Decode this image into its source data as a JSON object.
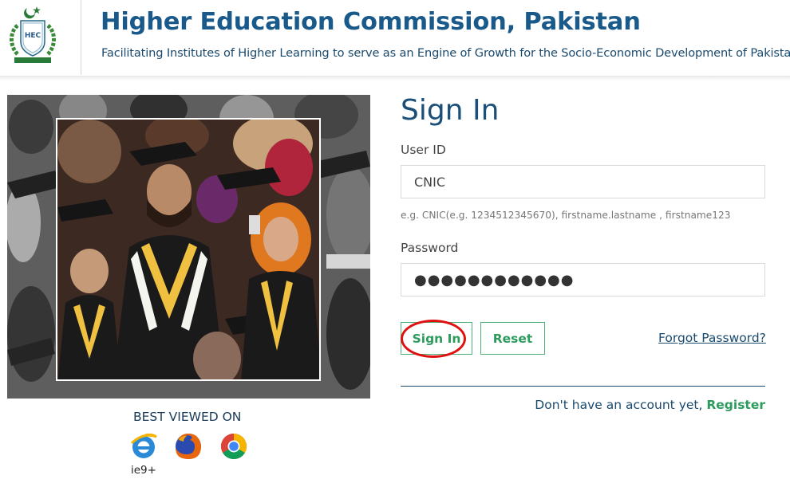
{
  "header": {
    "title": "Higher Education Commission, Pakistan",
    "tagline": "Facilitating Institutes of Higher Learning to serve as an Engine of Growth for the Socio-Economic Development of Pakistan",
    "logo_text": "HEC",
    "colors": {
      "title": "#1a5a8a",
      "logo_green": "#2a7a3a"
    }
  },
  "hero": {
    "icon": "graduates-photo"
  },
  "browsers": {
    "heading": "BEST VIEWED ON",
    "ie_label": "ie9+",
    "icons": [
      "ie-icon",
      "firefox-icon",
      "chrome-icon"
    ]
  },
  "form": {
    "title": "Sign In",
    "user_id_label": "User ID",
    "user_id_value": "CNIC",
    "user_id_hint": "e.g. CNIC(e.g. 1234512345670), firstname.lastname , firstname123",
    "password_label": "Password",
    "password_value": "●●●●●●●●●●●●",
    "signin_label": "Sign In",
    "reset_label": "Reset",
    "forgot_label": "Forgot Password?",
    "register_prompt": "Don't have an account yet,",
    "register_label": "Register",
    "colors": {
      "accent": "#2e9b5e",
      "annotation": "#e01010"
    }
  }
}
